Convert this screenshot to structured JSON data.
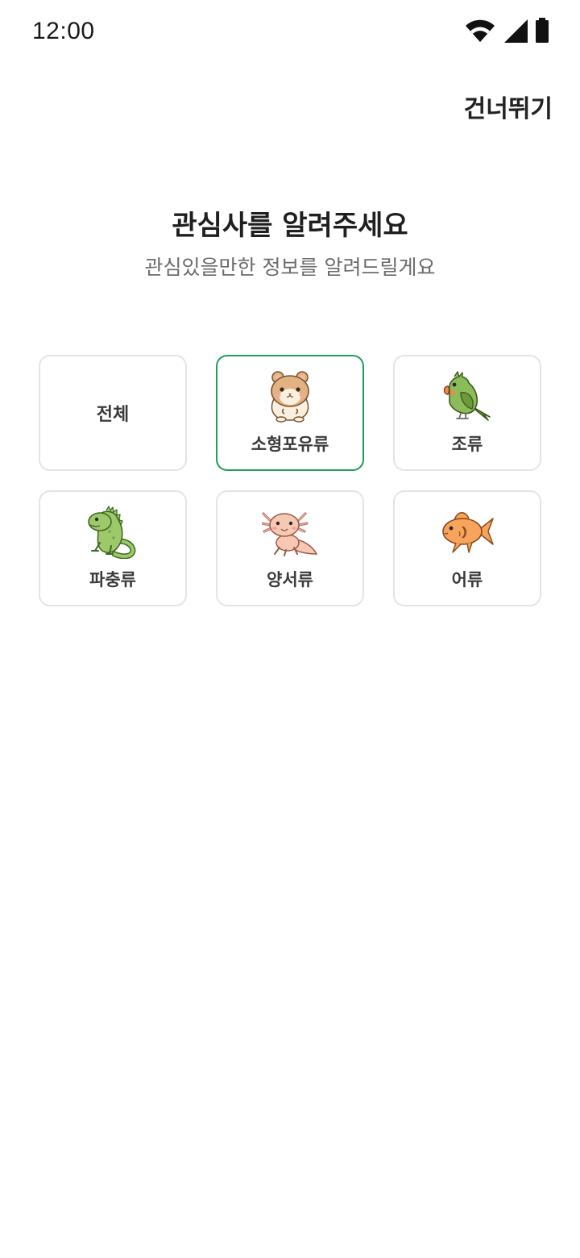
{
  "status_bar": {
    "time": "12:00"
  },
  "header": {
    "skip_label": "건너뛰기",
    "title": "관심사를 알려주세요",
    "subtitle": "관심있을만한 정보를 알려드릴게요"
  },
  "categories": [
    {
      "label": "전체",
      "icon": "none",
      "selected": false
    },
    {
      "label": "소형포유류",
      "icon": "hamster-icon",
      "selected": true
    },
    {
      "label": "조류",
      "icon": "parrot-icon",
      "selected": false
    },
    {
      "label": "파충류",
      "icon": "iguana-icon",
      "selected": false
    },
    {
      "label": "양서류",
      "icon": "axolotl-icon",
      "selected": false
    },
    {
      "label": "어류",
      "icon": "goldfish-icon",
      "selected": false
    }
  ],
  "colors": {
    "accent": "#1e9e5a",
    "card_border": "#e4e4e4"
  }
}
